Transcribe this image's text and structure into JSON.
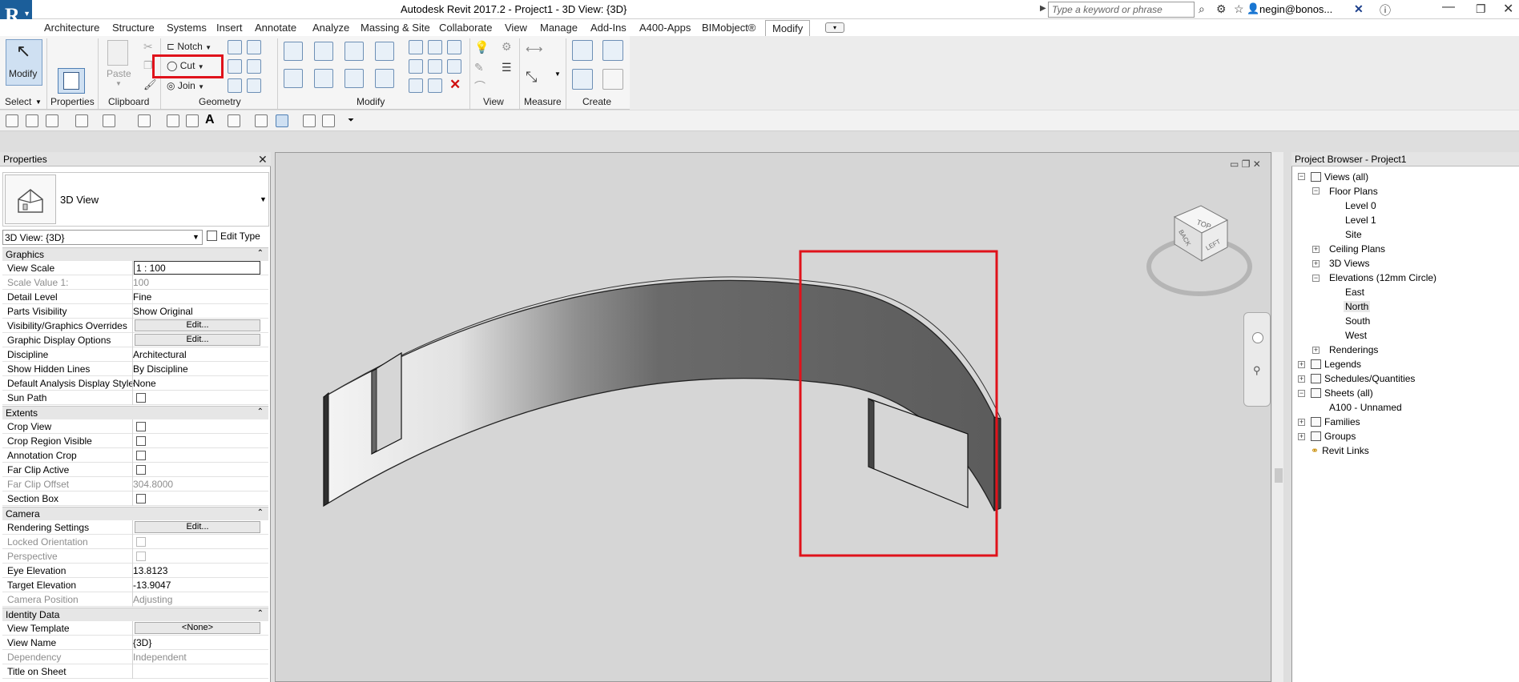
{
  "app": {
    "title": "Autodesk Revit 2017.2 -    Project1 - 3D View: {3D}",
    "logo_letter": "R",
    "search_placeholder": "Type a keyword or phrase",
    "user": "negin@bonos..."
  },
  "menu": [
    "Architecture",
    "Structure",
    "Systems",
    "Insert",
    "Annotate",
    "Analyze",
    "Massing & Site",
    "Collaborate",
    "View",
    "Manage",
    "Add-Ins",
    "A400-Apps",
    "BIMobject®",
    "Modify"
  ],
  "menu_active": "Modify",
  "ribbon": {
    "modify_label": "Modify",
    "paste_label": "Paste",
    "notch_label": "Notch",
    "cut_label": "Cut",
    "join_label": "Join",
    "panels": [
      "Select",
      "Properties",
      "Clipboard",
      "Geometry",
      "Modify",
      "View",
      "Measure",
      "Create"
    ]
  },
  "properties": {
    "header": "Properties",
    "type_name": "3D View",
    "view_selector": "3D View: {3D}",
    "edit_type": "Edit Type",
    "sections": {
      "graphics": "Graphics",
      "extents": "Extents",
      "camera": "Camera",
      "identity": "Identity Data"
    },
    "rows": {
      "view_scale": {
        "k": "View Scale",
        "v": "1 : 100"
      },
      "scale_value": {
        "k": "Scale Value    1:",
        "v": "100"
      },
      "detail_level": {
        "k": "Detail Level",
        "v": "Fine"
      },
      "parts_visibility": {
        "k": "Parts Visibility",
        "v": "Show Original"
      },
      "vg_overrides": {
        "k": "Visibility/Graphics Overrides",
        "v": "Edit..."
      },
      "graphic_display": {
        "k": "Graphic Display Options",
        "v": "Edit..."
      },
      "discipline": {
        "k": "Discipline",
        "v": "Architectural"
      },
      "hidden_lines": {
        "k": "Show Hidden Lines",
        "v": "By Discipline"
      },
      "analysis_style": {
        "k": "Default Analysis Display Style",
        "v": "None"
      },
      "sun_path": {
        "k": "Sun Path"
      },
      "crop_view": {
        "k": "Crop View"
      },
      "crop_region": {
        "k": "Crop Region Visible"
      },
      "annotation_crop": {
        "k": "Annotation Crop"
      },
      "far_clip_active": {
        "k": "Far Clip Active"
      },
      "far_clip_offset": {
        "k": "Far Clip Offset",
        "v": "304.8000"
      },
      "section_box": {
        "k": "Section Box"
      },
      "rendering_settings": {
        "k": "Rendering Settings",
        "v": "Edit..."
      },
      "locked_orientation": {
        "k": "Locked Orientation"
      },
      "perspective": {
        "k": "Perspective"
      },
      "eye_elevation": {
        "k": "Eye Elevation",
        "v": "13.8123"
      },
      "target_elevation": {
        "k": "Target Elevation",
        "v": "-13.9047"
      },
      "camera_position": {
        "k": "Camera Position",
        "v": "Adjusting"
      },
      "view_template": {
        "k": "View Template",
        "v": "<None>"
      },
      "view_name": {
        "k": "View Name",
        "v": "{3D}"
      },
      "dependency": {
        "k": "Dependency",
        "v": "Independent"
      },
      "title_on_sheet": {
        "k": "Title on Sheet"
      }
    }
  },
  "viewcube": {
    "top": "TOP",
    "back": "BACK",
    "left": "LEFT"
  },
  "browser": {
    "header": "Project Browser - Project1",
    "views_all": "Views (all)",
    "floor_plans": "Floor Plans",
    "level0": "Level 0",
    "level1": "Level 1",
    "site": "Site",
    "ceiling_plans": "Ceiling Plans",
    "views3d": "3D Views",
    "elevations": "Elevations (12mm Circle)",
    "east": "East",
    "north": "North",
    "south": "South",
    "west": "West",
    "renderings": "Renderings",
    "legends": "Legends",
    "schedules": "Schedules/Quantities",
    "sheets": "Sheets (all)",
    "a100": "A100 - Unnamed",
    "families": "Families",
    "groups": "Groups",
    "revit_links": "Revit Links"
  },
  "colors": {
    "highlight": "#e0121b",
    "ribbon_blue": "#1b5e9a"
  }
}
